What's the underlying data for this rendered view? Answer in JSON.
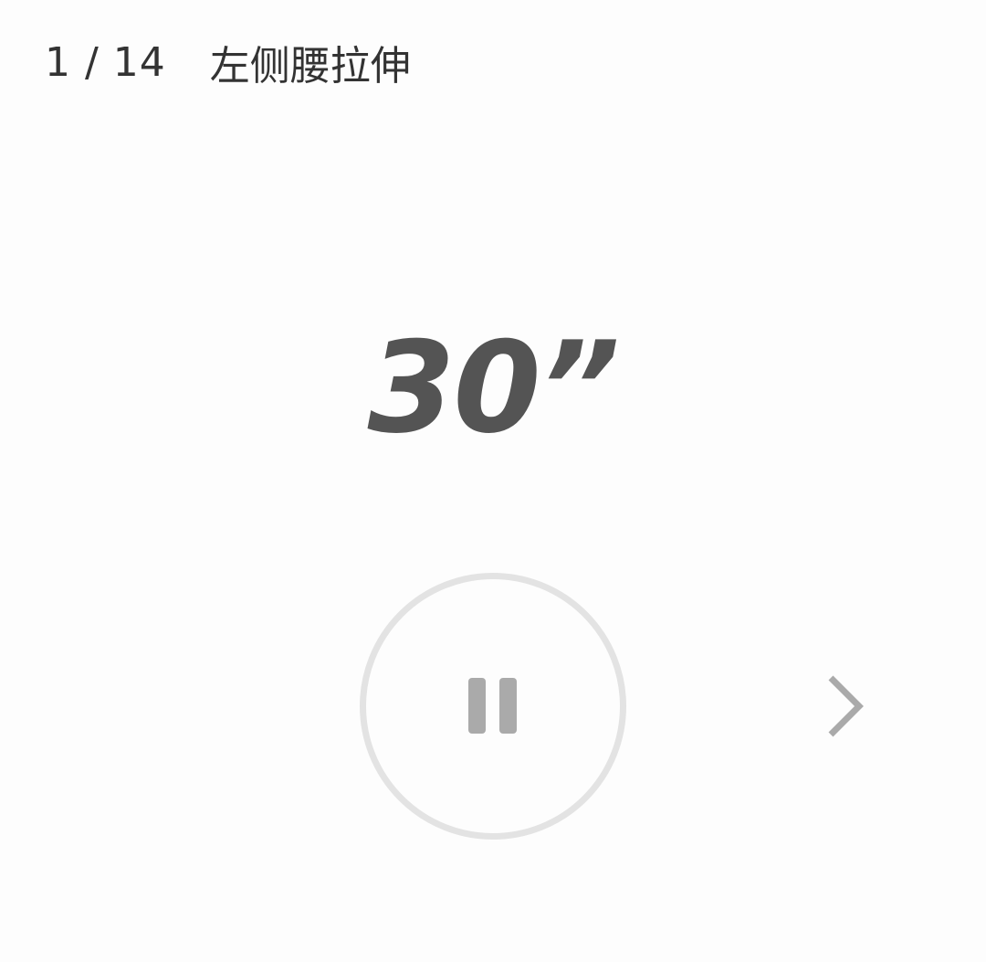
{
  "header": {
    "counter": "1 / 14",
    "exercise_name": "左侧腰拉伸"
  },
  "timer": {
    "display": "30”"
  },
  "controls": {
    "pause_icon": "pause-icon",
    "next_icon": "chevron-right-icon"
  },
  "colors": {
    "background": "#fdfdfd",
    "header_text": "#333333",
    "timer_text": "#545454",
    "ring": "#e3e3e3",
    "icon": "#aaaaaa"
  }
}
